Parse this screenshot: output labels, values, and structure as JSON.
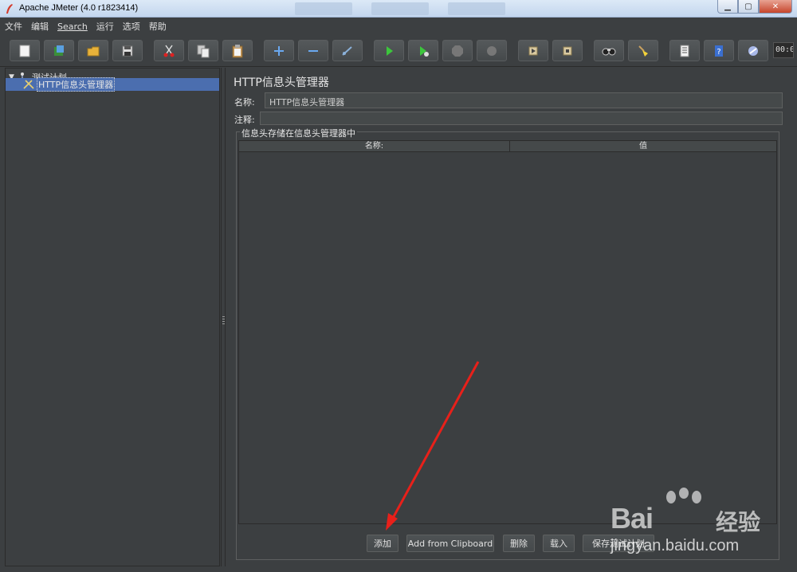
{
  "window": {
    "title": "Apache JMeter (4.0 r1823414)"
  },
  "menu": [
    "文件",
    "编辑",
    "Search",
    "运行",
    "选项",
    "帮助"
  ],
  "toolbar": {
    "buttons": [
      {
        "icon": "new-icon"
      },
      {
        "icon": "templates-icon"
      },
      {
        "icon": "open-icon"
      },
      {
        "icon": "save-icon"
      },
      {
        "icon": "cut-icon"
      },
      {
        "icon": "copy-icon"
      },
      {
        "icon": "paste-icon"
      },
      {
        "icon": "expand-icon"
      },
      {
        "icon": "collapse-icon"
      },
      {
        "icon": "toggle-icon"
      },
      {
        "icon": "start-icon"
      },
      {
        "icon": "start-no-pause-icon"
      },
      {
        "icon": "stop-icon"
      },
      {
        "icon": "shutdown-icon"
      },
      {
        "icon": "remote-start-icon"
      },
      {
        "icon": "remote-stop-icon"
      },
      {
        "icon": "search-icon"
      },
      {
        "icon": "clear-icon"
      },
      {
        "icon": "function-helper-icon"
      },
      {
        "icon": "help-icon"
      },
      {
        "icon": "log-viewer-icon"
      }
    ],
    "timer": "00:0"
  },
  "tree": {
    "root": "测试计划",
    "child": "HTTP信息头管理器"
  },
  "panel": {
    "title": "HTTP信息头管理器",
    "name_label": "名称:",
    "name_value": "HTTP信息头管理器",
    "comment_label": "注释:",
    "comment_value": "",
    "group_title": "信息头存储在信息头管理器中",
    "columns": [
      "名称:",
      "值"
    ],
    "buttons": {
      "add": "添加",
      "clipboard": "Add from Clipboard",
      "delete": "删除",
      "load": "载入",
      "save": "保存测试计划"
    }
  },
  "watermark": {
    "brand": "Bai",
    "brand_cn": "经验",
    "url": "jingyan.baidu.com"
  },
  "colors": {
    "background": "#3c3f41",
    "selection": "#4b6eaf",
    "arrow": "#e8201a"
  }
}
